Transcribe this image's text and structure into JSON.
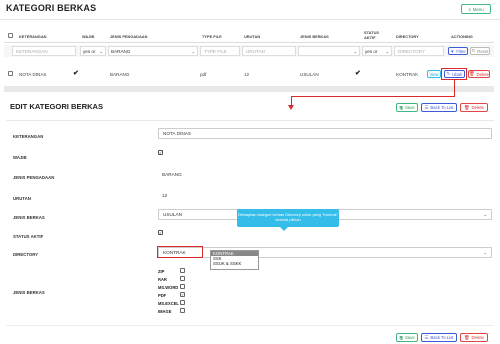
{
  "header": {
    "title": "KATEGORI BERKAS",
    "menu_label": "Menu"
  },
  "table": {
    "columns": [
      "KETERANGAN",
      "WAJIB",
      "JENIS PENGADAAN",
      "TYPE FILE",
      "URUTAN",
      "JENIS BERKAS",
      "STATUS AKTIF",
      "DIRECTORY",
      "ACTIONING"
    ],
    "filters": {
      "keterangan_placeholder": "KETERANGAN",
      "wajib_value": "yes or",
      "jenis_pengadaan_value": "BARANG",
      "type_file_placeholder": "TYPE FILE",
      "urutan_placeholder": "URUTAN",
      "status_value": "yes or",
      "directory_placeholder": "DIRECTORY",
      "filter_label": "Filter",
      "reset_label": "Reset"
    },
    "rows": [
      {
        "keterangan": "NOTA DINAS",
        "jenis_pengadaan": "BARANG",
        "type_file": "pdf",
        "urutan": "12",
        "jenis_berkas": "USULAN",
        "directory": "KONTRAK",
        "actions": {
          "view": "View",
          "edit": "Ubah",
          "delete": "Delete"
        }
      }
    ]
  },
  "edit": {
    "title": "EDIT KATEGORI BERKAS",
    "buttons": {
      "save": "Save",
      "back": "Back To List",
      "delete": "Delete"
    },
    "fields": {
      "keterangan": {
        "label": "KETERANGAN",
        "value": "NOTA DINAS"
      },
      "wajib": {
        "label": "WAJIB",
        "checked": true
      },
      "jenis_pengadaan": {
        "label": "JENIS PENGADAAN",
        "value": "BARANG"
      },
      "urutan": {
        "label": "URUTAN",
        "value": "12"
      },
      "jenis_berkas": {
        "label": "JENIS BERKAS",
        "value": "USULAN"
      },
      "status_aktif": {
        "label": "STATUS AKTIF",
        "checked": true
      },
      "directory": {
        "label": "DIRECTORY",
        "value": "KONTRAK",
        "options": [
          "KONTRAK",
          "SSK",
          "SSUK & SSKK"
        ]
      },
      "jenis_berkas_files": {
        "label": "JENIS BERKAS",
        "items": [
          {
            "name": "ZIP",
            "checked": false
          },
          {
            "name": "RAR",
            "checked": false
          },
          {
            "name": "MS.WORD",
            "checked": false
          },
          {
            "name": "PDF",
            "checked": true
          },
          {
            "name": "MS.EXCEL",
            "checked": false
          },
          {
            "name": "IMAGE",
            "checked": false
          }
        ]
      }
    },
    "tooltip": "Ditetapkan kategori berkas Directory untuk yang \"Kontrak\" beserta pilihan"
  },
  "colors": {
    "accent_green": "#41b883",
    "accent_blue": "#3d5bd9",
    "accent_red": "#e04848",
    "tooltip": "#33bde8",
    "annotation_red": "#d92b2b"
  }
}
